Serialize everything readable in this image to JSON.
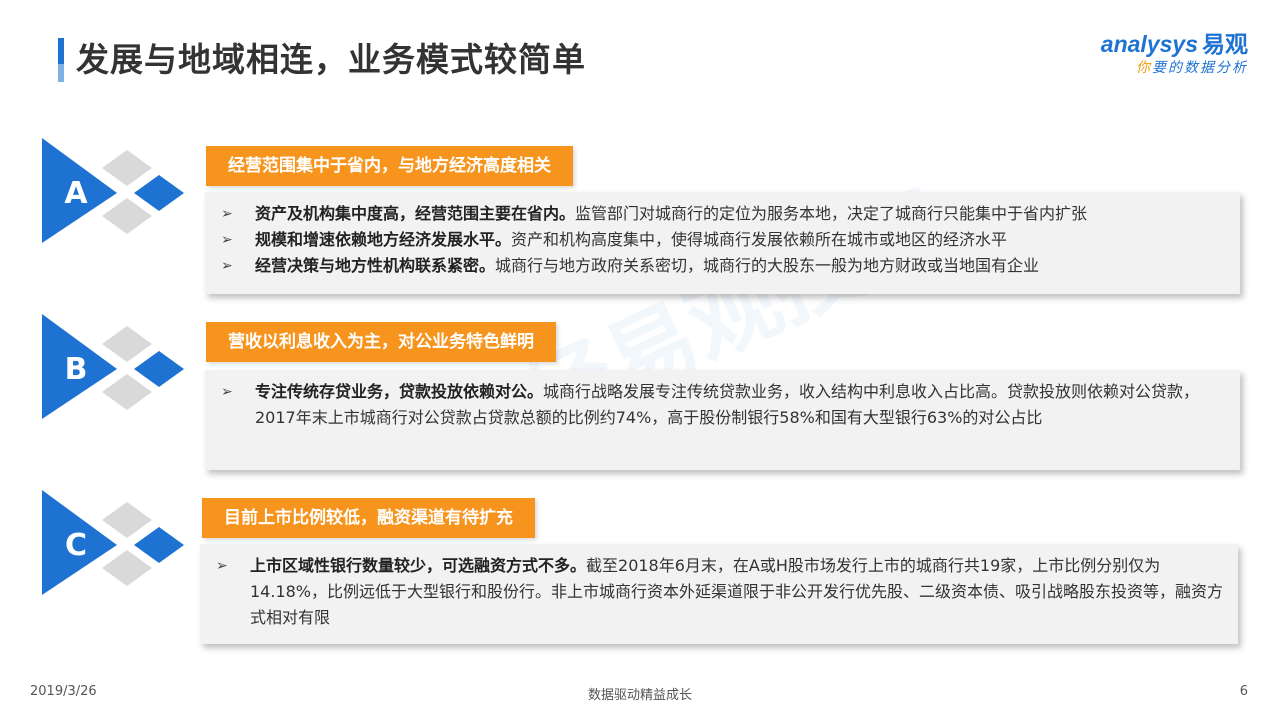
{
  "title": "发展与地域相连，业务模式较简单",
  "logo": {
    "brand_en": "analysys",
    "brand_cn": "易观",
    "slogan_accent": "你",
    "slogan_rest": "要的数据分析"
  },
  "watermark": "非经易观授权",
  "colors": {
    "primary_blue": "#1e73d2",
    "orange": "#f7941d",
    "box_bg": "#f2f2f2"
  },
  "sections": [
    {
      "letter": "A",
      "tag": "经营范围集中于省内，与地方经济高度相关",
      "bullets": [
        {
          "bold": "资产及机构集中度高，经营范围主要在省内。",
          "text": "监管部门对城商行的定位为服务本地，决定了城商行只能集中于省内扩张"
        },
        {
          "bold": "规模和增速依赖地方经济发展水平。",
          "text": "资产和机构高度集中，使得城商行发展依赖所在城市或地区的经济水平"
        },
        {
          "bold": "经营决策与地方性机构联系紧密。",
          "text": "城商行与地方政府关系密切，城商行的大股东一般为地方财政或当地国有企业"
        }
      ]
    },
    {
      "letter": "B",
      "tag": "营收以利息收入为主，对公业务特色鲜明",
      "bullets": [
        {
          "bold": "专注传统存贷业务，贷款投放依赖对公。",
          "text": "城商行战略发展专注传统贷款业务，收入结构中利息收入占比高。贷款投放则依赖对公贷款，2017年末上市城商行对公贷款占贷款总额的比例约74%，高于股份制银行58%和国有大型银行63%的对公占比"
        }
      ]
    },
    {
      "letter": "C",
      "tag": "目前上市比例较低，融资渠道有待扩充",
      "bullets": [
        {
          "bold": "上市区域性银行数量较少，可选融资方式不多。",
          "text": "截至2018年6月末，在A或H股市场发行上市的城商行共19家，上市比例分别仅为14.18%，比例远低于大型银行和股份行。非上市城商行资本外延渠道限于非公开发行优先股、二级资本债、吸引战略股东投资等，融资方式相对有限"
        }
      ]
    }
  ],
  "footer": {
    "date": "2019/3/26",
    "center": "数据驱动精益成长",
    "page": "6"
  }
}
